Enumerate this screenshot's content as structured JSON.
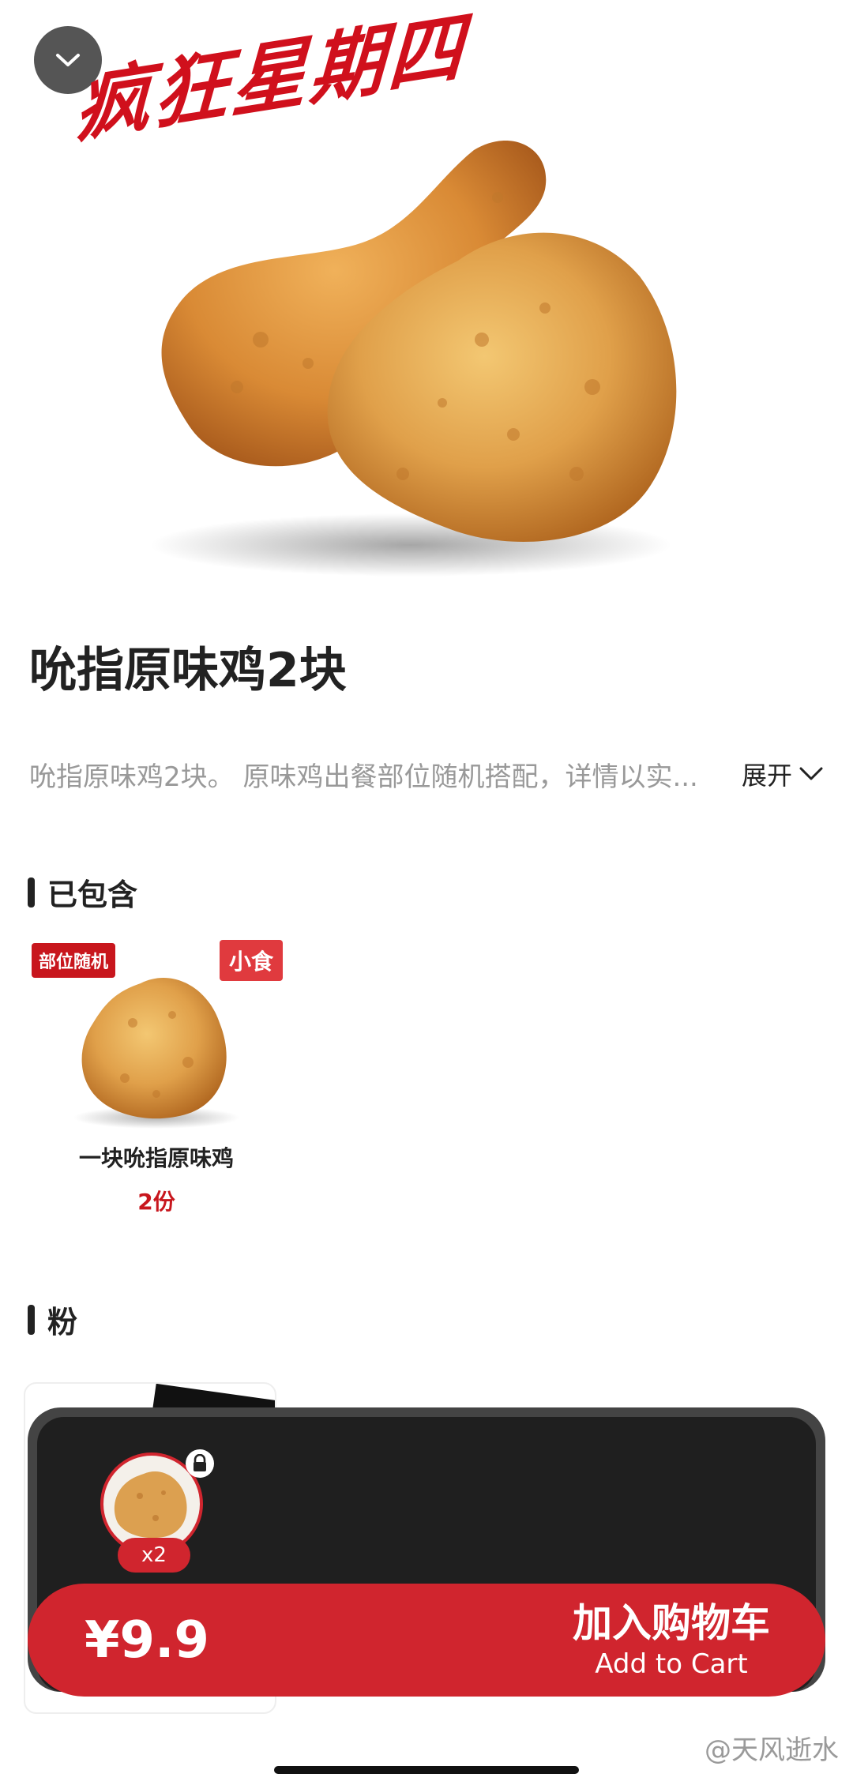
{
  "hero": {
    "promo_title": "疯狂星期四",
    "image_icon": "fried-chicken-image"
  },
  "product": {
    "title": "吮指原味鸡2块",
    "description": "吮指原味鸡2块。 原味鸡出餐部位随机搭配，详情以实...",
    "expand_label": "展开"
  },
  "included": {
    "section_label": "已包含",
    "items": [
      {
        "tag_left": "部位随机",
        "tag_right": "小食",
        "name": "一块吮指原味鸡",
        "qty": "2份"
      }
    ]
  },
  "second_section": {
    "section_label": "粉"
  },
  "cart_sheet": {
    "thumb_qty": "x2",
    "price": "¥9.9",
    "add_to_cart_cn": "加入购物车",
    "add_to_cart_en": "Add to Cart"
  },
  "watermark": "@天风逝水",
  "colors": {
    "brand_red": "#d0252e",
    "promo_red": "#d0101c",
    "sheet_dark": "#1f1f1f"
  }
}
